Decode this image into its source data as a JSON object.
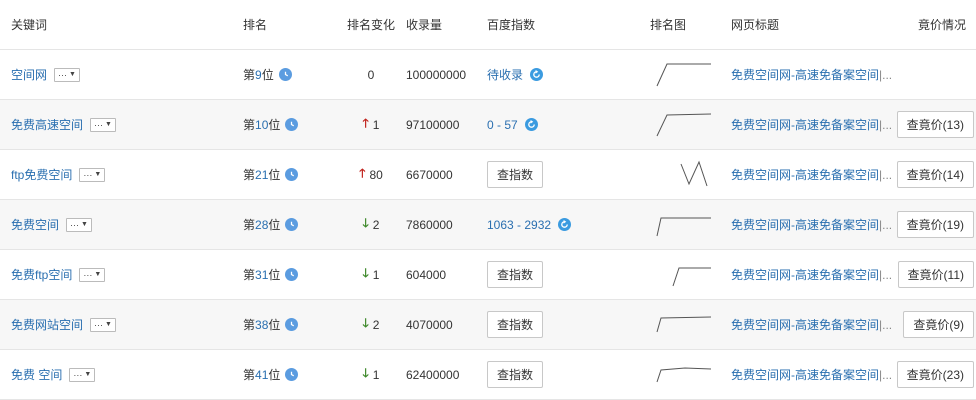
{
  "header": {
    "keyword": "关键词",
    "rank": "排名",
    "rank_change": "排名变化",
    "indexed": "收录量",
    "baidu_index": "百度指数",
    "rank_chart": "排名图",
    "page_title": "网页标题",
    "bid_status": "竟价情况"
  },
  "rows": [
    {
      "keyword": "空间网",
      "rank_prefix": "第",
      "rank_num": "9",
      "rank_suffix": "位",
      "change_dir": "none",
      "change": "0",
      "indexed": "100000000",
      "index_type": "link",
      "index_text": "待收录",
      "title": "免费空间网-高速免备案空间",
      "title_ellipsis": "|...",
      "bid": ""
    },
    {
      "keyword": "免费高速空间",
      "rank_prefix": "第",
      "rank_num": "10",
      "rank_suffix": "位",
      "change_dir": "up",
      "change": "1",
      "indexed": "97100000",
      "index_type": "link",
      "index_text": "0 - 57",
      "title": "免费空间网-高速免备案空间",
      "title_ellipsis": "|...",
      "bid": "查竟价(13)"
    },
    {
      "keyword": "ftp免费空间",
      "rank_prefix": "第",
      "rank_num": "21",
      "rank_suffix": "位",
      "change_dir": "up",
      "change": "80",
      "indexed": "6670000",
      "index_type": "button",
      "index_text": "查指数",
      "title": "免费空间网-高速免备案空间",
      "title_ellipsis": "|...",
      "bid": "查竟价(14)"
    },
    {
      "keyword": "免费空间",
      "rank_prefix": "第",
      "rank_num": "28",
      "rank_suffix": "位",
      "change_dir": "down",
      "change": "2",
      "indexed": "7860000",
      "index_type": "link",
      "index_text": "1063 - 2932",
      "title": "免费空间网-高速免备案空间",
      "title_ellipsis": "|...",
      "bid": "查竟价(19)"
    },
    {
      "keyword": "免费ftp空间",
      "rank_prefix": "第",
      "rank_num": "31",
      "rank_suffix": "位",
      "change_dir": "down",
      "change": "1",
      "indexed": "604000",
      "index_type": "button",
      "index_text": "查指数",
      "title": "免费空间网-高速免备案空间",
      "title_ellipsis": "|...",
      "bid": "查竟价(11)"
    },
    {
      "keyword": "免费网站空间",
      "rank_prefix": "第",
      "rank_num": "38",
      "rank_suffix": "位",
      "change_dir": "down",
      "change": "2",
      "indexed": "4070000",
      "index_type": "button",
      "index_text": "查指数",
      "title": "免费空间网-高速免备案空间",
      "title_ellipsis": "|...",
      "bid": "查竟价(9)"
    },
    {
      "keyword": "免费 空间",
      "rank_prefix": "第",
      "rank_num": "41",
      "rank_suffix": "位",
      "change_dir": "down",
      "change": "1",
      "indexed": "62400000",
      "index_type": "button",
      "index_text": "查指数",
      "title": "免费空间网-高速免备案空间",
      "title_ellipsis": "|...",
      "bid": "查竟价(23)"
    }
  ],
  "colors": {
    "link": "#2a6fb0",
    "up": "#c0241e",
    "down": "#3f8a2c",
    "clock": "#5b9ce0"
  }
}
